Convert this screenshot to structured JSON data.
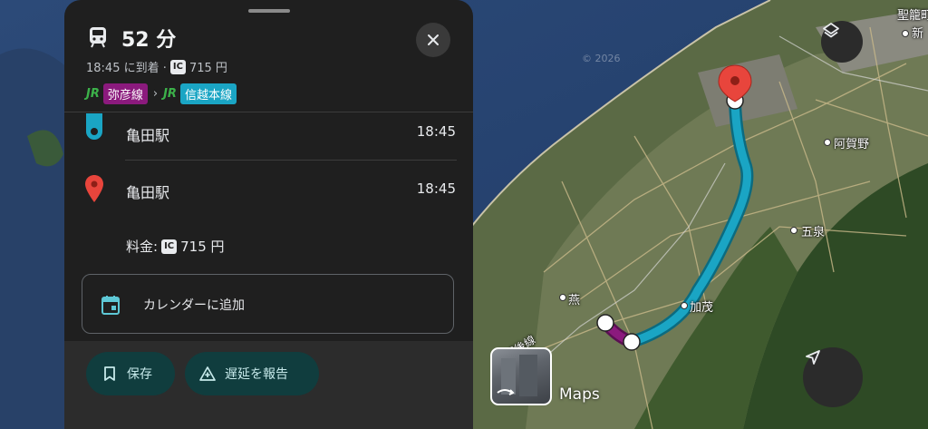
{
  "route": {
    "duration": "52 分",
    "arrival_text": "18:45 に到着 ·",
    "ic_label": "IC",
    "fare_amount": "715 円",
    "lines": [
      {
        "operator": "JR",
        "name": "弥彦線",
        "color": "#8b1a7d"
      },
      {
        "operator": "JR",
        "name": "信越本線",
        "color": "#1aa5c4"
      }
    ]
  },
  "stops": [
    {
      "name": "亀田駅",
      "time": "18:45",
      "marker": "station-icon"
    },
    {
      "name": "亀田駅",
      "time": "18:45",
      "marker": "destination-pin-icon"
    }
  ],
  "fare": {
    "label": "料金:",
    "ic_label": "IC",
    "amount": "715 円"
  },
  "calendar": {
    "label": "カレンダーに追加",
    "icon": "calendar-icon"
  },
  "actions": {
    "save": "保存",
    "report_delay": "遅延を報告"
  },
  "map": {
    "labels": {
      "seirou": "聖籠町",
      "shin": "新",
      "agano": "阿賀野",
      "gosen": "五泉",
      "kamo": "加茂",
      "tsubame": "燕",
      "etsugo_line": "越後線"
    },
    "copyright": "© 2026",
    "wordmark": "Maps",
    "colors": {
      "shinetsu": "#1aa5c4",
      "yahiko": "#8b1a7d",
      "pin": "#e8453c"
    }
  },
  "icons": {
    "close": "close-icon",
    "layers": "layers-icon",
    "navigate": "navigation-arrow-icon",
    "train": "train-icon"
  }
}
